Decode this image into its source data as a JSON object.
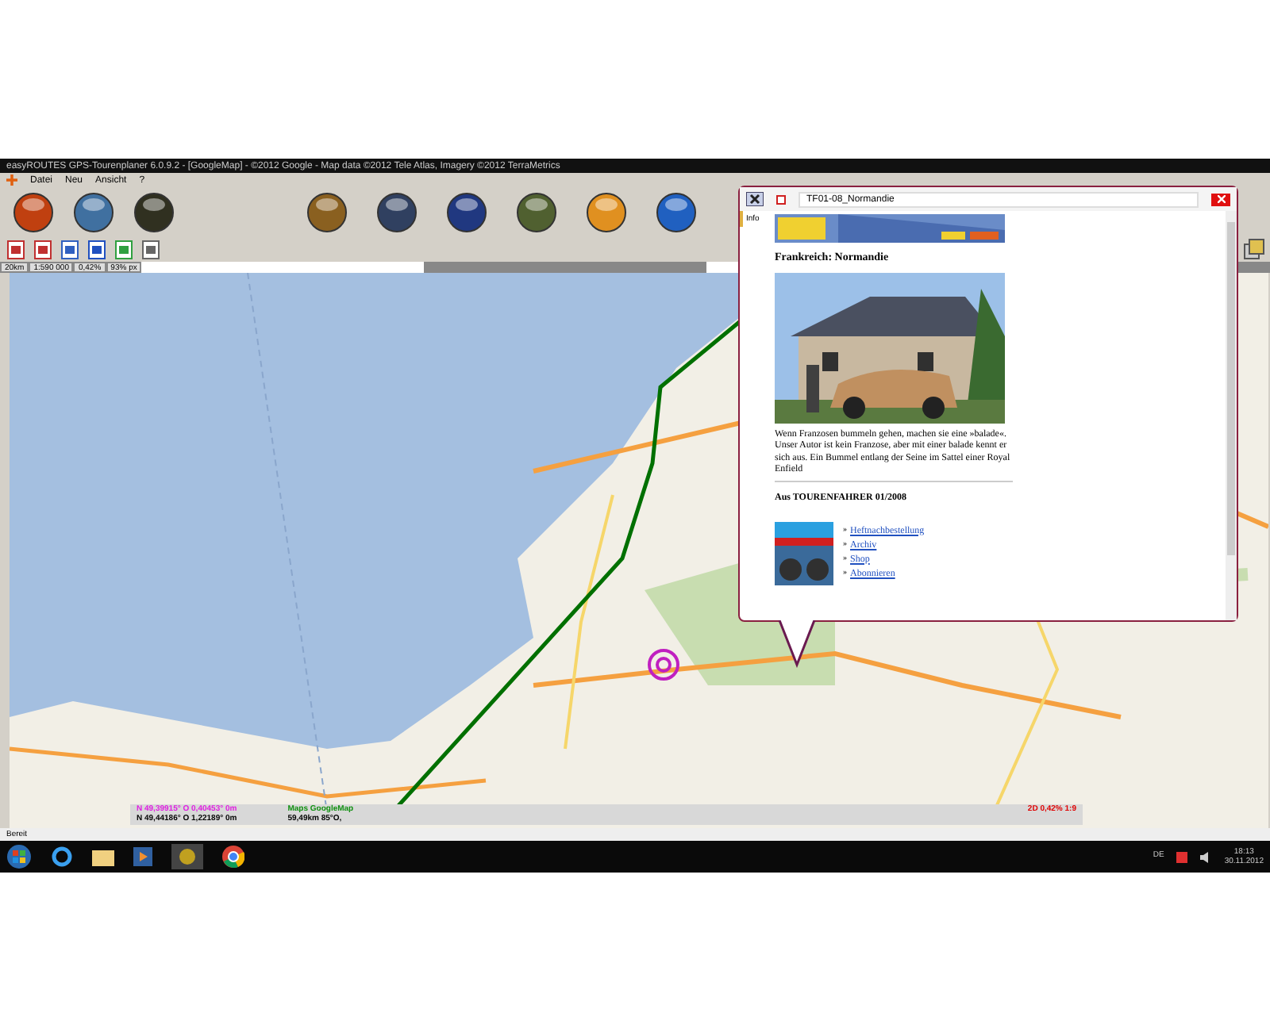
{
  "window": {
    "title": "easyROUTES GPS-Tourenplaner 6.0.9.2 - [GoogleMap] - ©2012 Google - Map data ©2012 Tele Atlas, Imagery ©2012 TerraMetrics"
  },
  "menu": [
    "Datei",
    "Neu",
    "Ansicht",
    "?"
  ],
  "scale_bar": [
    "20km",
    "1:590 000",
    "0,42%",
    "93% px"
  ],
  "info_panel": {
    "lines": [
      {
        "text": "N 49,39915°  O 0,40453°  0m",
        "kind": "highlight"
      },
      {
        "text": "N 49,44186°  O 1,22189°  0m",
        "kind": "plain"
      }
    ],
    "source": "Maps GoogleMap",
    "distance": "59,49km 85°O,",
    "view": "2D 0,42% 1:9"
  },
  "popup": {
    "title": "TF01-08_Normandie",
    "tabs": [
      {
        "label": "Info",
        "selected": true
      }
    ],
    "heading": "Frankreich: Normandie",
    "paragraph": "Wenn Franzosen bummeln gehen, machen sie eine »balade«. Unser Autor ist kein Franzose, aber mit einer balade kennt er sich aus. Ein Bummel entlang der Seine im Sattel einer Royal Enfield",
    "source": "Aus TOURENFAHRER 01/2008",
    "links": [
      "Heftnachbestellung",
      "Archiv",
      "Shop",
      "Abonnieren"
    ],
    "bullet": "»"
  },
  "status_bar": "Bereit",
  "taskbar": {
    "language": "DE",
    "time": "18:13",
    "date": "30.11.2012"
  }
}
